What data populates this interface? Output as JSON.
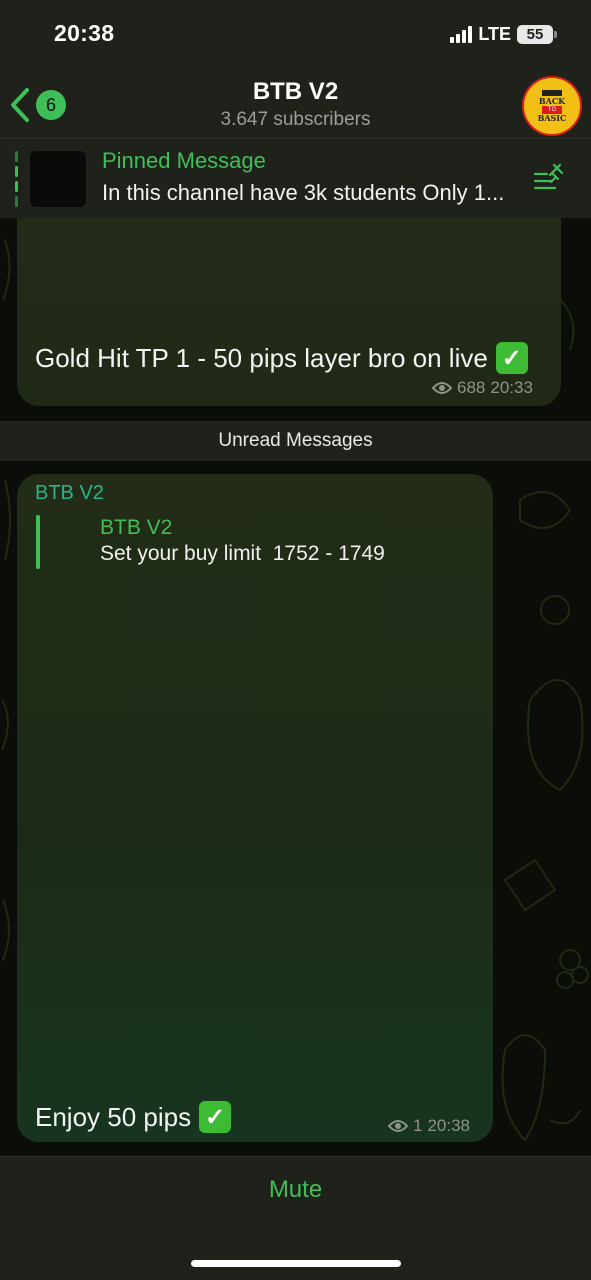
{
  "status_bar": {
    "time": "20:38",
    "network": "LTE",
    "battery": "55"
  },
  "header": {
    "back_badge": "6",
    "title": "BTB V2",
    "subtitle": "3.647 subscribers",
    "avatar_logo_text": [
      "BACK",
      "TO",
      "BASIC"
    ]
  },
  "pinned": {
    "title": "Pinned Message",
    "text": "In this channel have 3k students Only 1..."
  },
  "messages": [
    {
      "text": "Gold Hit TP 1 - 50 pips layer bro on live",
      "views": "688",
      "time": "20:33"
    },
    {
      "author": "BTB V2",
      "reply": {
        "author": "BTB V2",
        "text": "Set your buy limit  1752 - 1749"
      },
      "text": "Enjoy 50 pips",
      "views": "1",
      "time": "20:38"
    }
  ],
  "divider": "Unread Messages",
  "bottom": {
    "mute_label": "Mute"
  },
  "colors": {
    "accent": "#3fbf58",
    "author": "#29b48a",
    "bar_bg": "#1f211b",
    "bubble_bg": "#1e2916"
  }
}
